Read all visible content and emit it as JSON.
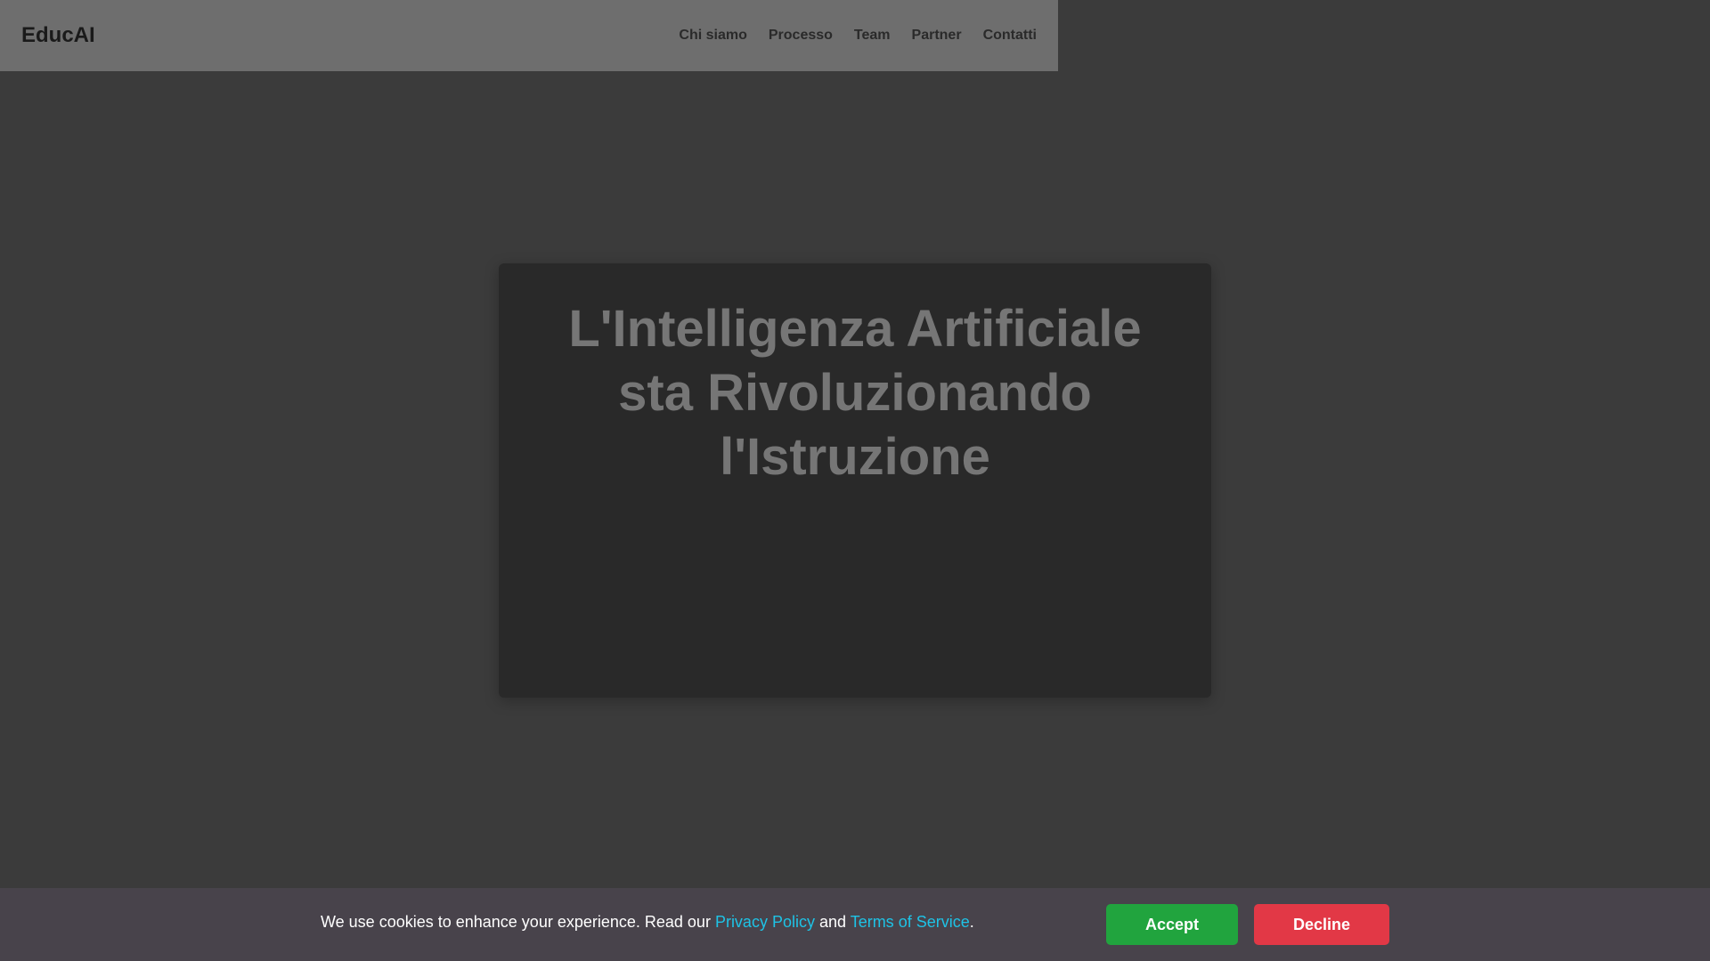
{
  "header": {
    "brand": "EducAI",
    "nav": [
      "Chi siamo",
      "Processo",
      "Team",
      "Partner",
      "Contatti"
    ]
  },
  "hero": {
    "title_lines": [
      "L'Intelligenza Artificiale",
      "sta Rivoluzionando",
      "l'Istruzione"
    ]
  },
  "cookie": {
    "text_before": "We use cookies to enhance your experience. Read our ",
    "privacy_link": "Privacy Policy",
    "text_mid": " and ",
    "terms_link": "Terms of Service",
    "text_end": ".",
    "accept_label": "Accept",
    "decline_label": "Decline"
  },
  "colors": {
    "page_bg": "#3b3b3b",
    "navbar_bg": "#6e6e6e",
    "hero_card_bg": "#292929",
    "cookie_bar_bg": "#48434b",
    "link": "#1ec3e6",
    "accept": "#21a43e",
    "decline": "#e23846"
  }
}
